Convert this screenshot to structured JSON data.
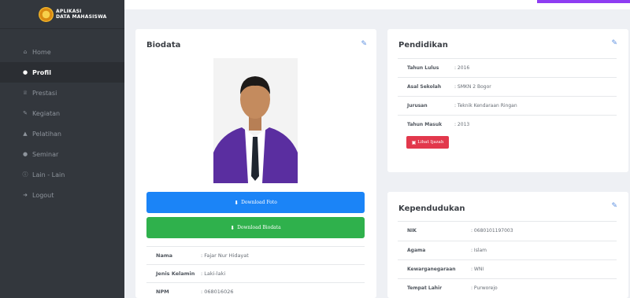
{
  "brand": {
    "line1": "APLIKASI",
    "line2": "DATA MAHASISWA"
  },
  "sidebar": {
    "items": [
      {
        "label": "Home",
        "icon": "home-icon"
      },
      {
        "label": "Profil",
        "icon": "user-icon",
        "active": true
      },
      {
        "label": "Prestasi",
        "icon": "trophy-icon"
      },
      {
        "label": "Kegiatan",
        "icon": "edit-icon"
      },
      {
        "label": "Pelatihan",
        "icon": "graduation-cap-icon"
      },
      {
        "label": "Seminar",
        "icon": "circle-icon"
      },
      {
        "label": "Lain - Lain",
        "icon": "info-icon"
      },
      {
        "label": "Logout",
        "icon": "sign-out-icon"
      }
    ]
  },
  "colors": {
    "sidebar_bg": "#33373d",
    "accent": "#8e3df2",
    "blue": "#1b84f7",
    "green": "#2fb14c",
    "red": "#e2384c"
  },
  "biodata": {
    "title": "Biodata",
    "download_foto": "Download Foto",
    "download_biodata": "Download Biodata",
    "fields": [
      {
        "key": "Nama",
        "value": ": Fajar Nur Hidayat"
      },
      {
        "key": "Jenis Kelamin",
        "value": ": Laki-laki"
      },
      {
        "key": "NPM",
        "value": ": 068016026"
      }
    ]
  },
  "pendidikan": {
    "title": "Pendidikan",
    "fields": [
      {
        "key": "Tahun Lulus",
        "value": ": 2016"
      },
      {
        "key": "Asal Sekolah",
        "value": ": SMKN 2 Bogor"
      },
      {
        "key": "Jurusan",
        "value": ": Teknik Kendaraan Ringan"
      },
      {
        "key": "Tahun Masuk",
        "value": ": 2013"
      }
    ],
    "button": "Lihat Ijazah"
  },
  "kependudukan": {
    "title": "Kependudukan",
    "fields": [
      {
        "key": "NIK",
        "value": ": 0680101197003"
      },
      {
        "key": "Agama",
        "value": ": Islam"
      },
      {
        "key": "Kewarganegaraan",
        "value": ": WNI"
      },
      {
        "key": "Tempat Lahir",
        "value": ": Purworejo"
      }
    ]
  }
}
